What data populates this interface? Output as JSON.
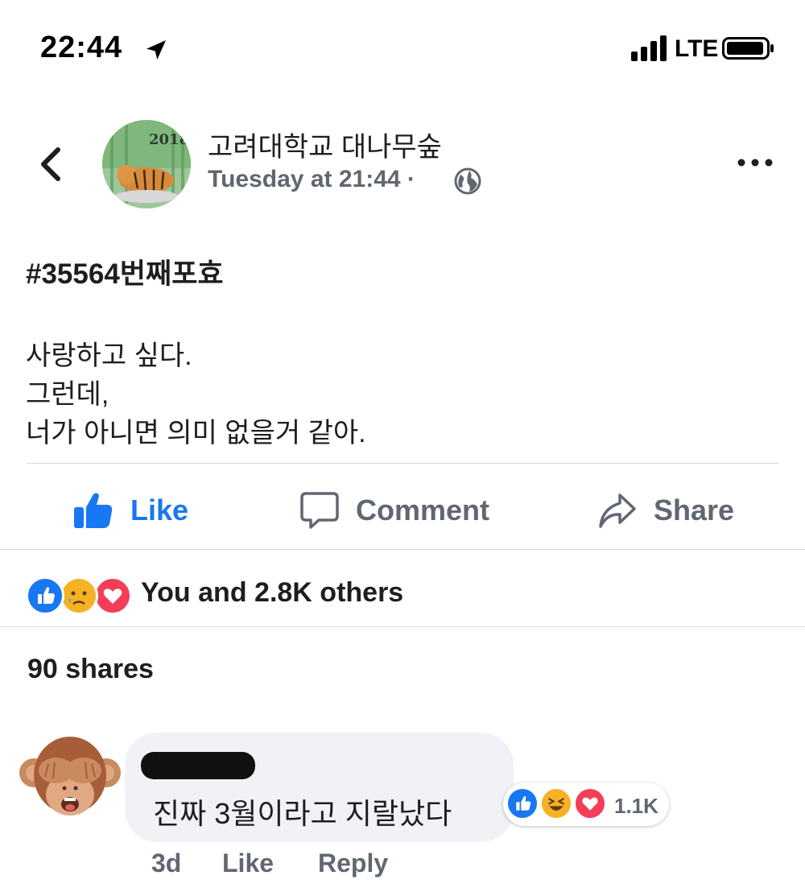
{
  "status_bar": {
    "time": "22:44",
    "network": "LTE"
  },
  "header": {
    "page_name": "고려대학교 대나무숲",
    "timestamp": "Tuesday at 21:44",
    "separator": "·",
    "avatar_text": "2018"
  },
  "post": {
    "hashtag": "#35564번째포효",
    "lines": [
      "사랑하고 싶다.",
      "그런데,",
      "너가 아니면 의미 없을거 같아."
    ]
  },
  "actions": {
    "like": "Like",
    "comment": "Comment",
    "share": "Share"
  },
  "reactions": {
    "summary": "You and 2.8K others",
    "icons": [
      "like-icon",
      "sad-icon",
      "love-icon"
    ]
  },
  "shares": "90 shares",
  "comment": {
    "text": "진짜 3월이라고 지랄났다",
    "reaction_count": "1.1K",
    "reaction_icons": [
      "like-icon",
      "haha-icon",
      "love-icon"
    ],
    "time": "3d",
    "like": "Like",
    "reply": "Reply"
  },
  "colors": {
    "brand_blue": "#1877f2",
    "secondary_text": "#606770",
    "love_red": "#f33e58",
    "emoji_yellow": "#f7b125"
  }
}
